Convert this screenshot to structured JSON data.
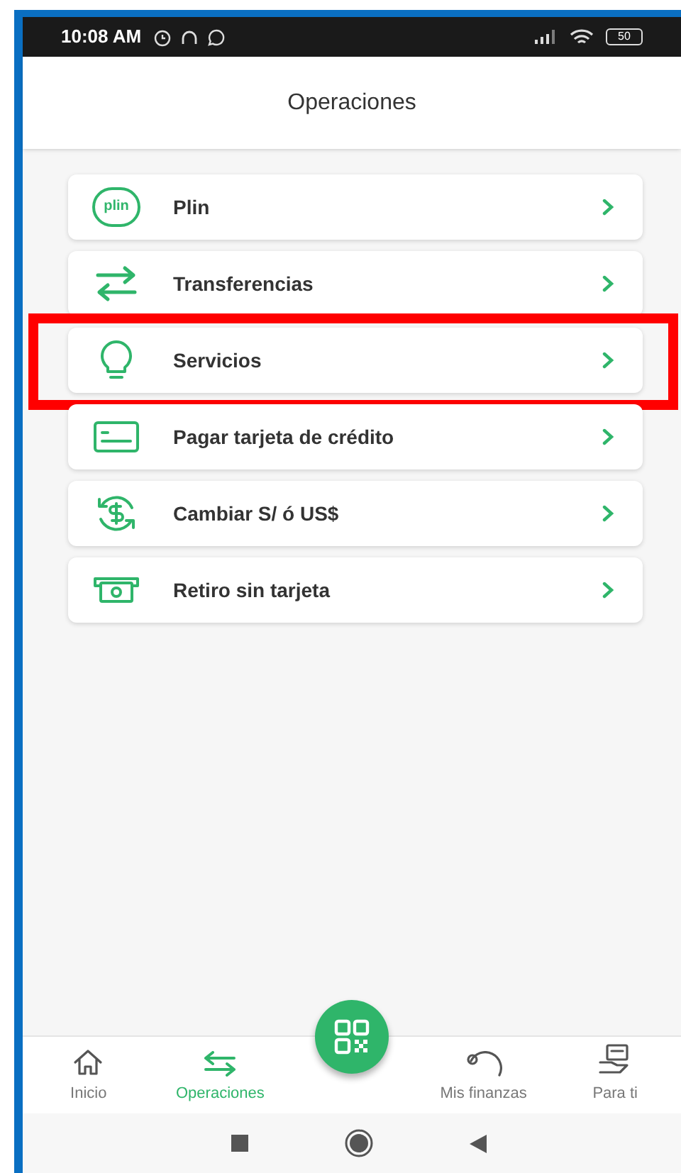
{
  "status_bar": {
    "time": "10:08 AM",
    "battery": "50"
  },
  "header": {
    "title": "Operaciones"
  },
  "items": [
    {
      "kind": "plin",
      "logo_text": "plin",
      "label": "Plin",
      "highlighted": false
    },
    {
      "kind": "transfer",
      "label": "Transferencias",
      "highlighted": false
    },
    {
      "kind": "bulb",
      "label": "Servicios",
      "highlighted": true
    },
    {
      "kind": "card",
      "label": "Pagar tarjeta de crédito",
      "highlighted": false
    },
    {
      "kind": "exchange",
      "label": "Cambiar S/ ó US$",
      "highlighted": false
    },
    {
      "kind": "cash",
      "label": "Retiro sin tarjeta",
      "highlighted": false
    }
  ],
  "bottom_nav": [
    {
      "kind": "home",
      "label": "Inicio",
      "selected": false
    },
    {
      "kind": "arrows",
      "label": "Operaciones",
      "selected": true
    },
    {
      "kind": "qr",
      "selected": false
    },
    {
      "kind": "finance",
      "label": "Mis finanzas",
      "selected": false
    },
    {
      "kind": "hand",
      "label": "Para ti",
      "selected": false
    }
  ]
}
